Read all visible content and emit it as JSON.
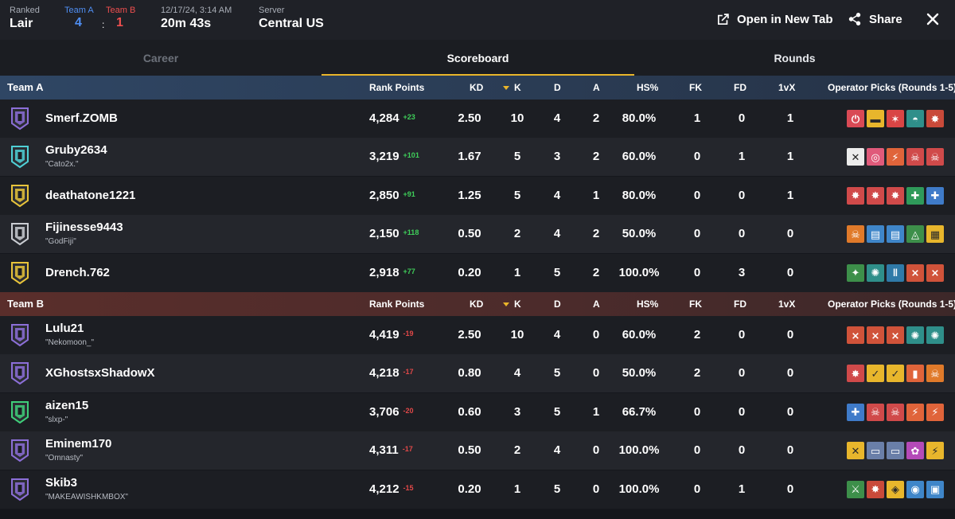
{
  "header": {
    "mode_label": "Ranked",
    "map": "Lair",
    "team_a_label": "Team A",
    "team_b_label": "Team B",
    "team_a_score": "4",
    "team_b_score": "1",
    "score_separator": ":",
    "datetime": "12/17/24, 3:14 AM",
    "duration": "20m 43s",
    "server_label": "Server",
    "server": "Central US",
    "open_new_tab": "Open in New Tab",
    "share": "Share"
  },
  "tabs": [
    {
      "label": "Career"
    },
    {
      "label": "Scoreboard"
    },
    {
      "label": "Rounds"
    }
  ],
  "columns": {
    "rank_points": "Rank Points",
    "kd": "KD",
    "k": "K",
    "d": "D",
    "a": "A",
    "hs": "HS%",
    "fk": "FK",
    "fd": "FD",
    "clutch": "1vX",
    "operators": "Operator Picks (Rounds 1-5)"
  },
  "teams": [
    {
      "name": "Team A",
      "players": [
        {
          "name": "Smerf.ZOMB",
          "nick": "",
          "rank_color": "#8c6fd8",
          "rp": "4,284",
          "delta": "+23",
          "kd": "2.50",
          "k": "10",
          "d": "4",
          "a": "2",
          "hs": "80.0%",
          "fk": "1",
          "fd": "0",
          "clutch": "1",
          "ops": [
            {
              "bg": "#d94a55",
              "fg": "#ffffff",
              "glyph": "⏻"
            },
            {
              "bg": "#e8b62c",
              "fg": "#2a2a2a",
              "glyph": "▬"
            },
            {
              "bg": "#d94545",
              "fg": "#ffffff",
              "glyph": "✶"
            },
            {
              "bg": "#2f8f8a",
              "fg": "#ffffff",
              "glyph": "◓"
            },
            {
              "bg": "#c94a3a",
              "fg": "#ffffff",
              "glyph": "✸"
            }
          ]
        },
        {
          "name": "Gruby2634",
          "nick": "\"Cato2x.\"",
          "rank_color": "#4fd0d6",
          "rp": "3,219",
          "delta": "+101",
          "kd": "1.67",
          "k": "5",
          "d": "3",
          "a": "2",
          "hs": "60.0%",
          "fk": "0",
          "fd": "1",
          "clutch": "1",
          "ops": [
            {
              "bg": "#ececec",
              "fg": "#222222",
              "glyph": "✕"
            },
            {
              "bg": "#e05a7a",
              "fg": "#ffffff",
              "glyph": "◎"
            },
            {
              "bg": "#e0643a",
              "fg": "#ffffff",
              "glyph": "⚡"
            },
            {
              "bg": "#d04a4a",
              "fg": "#ffffff",
              "glyph": "☠"
            },
            {
              "bg": "#d04a4a",
              "fg": "#ffffff",
              "glyph": "☠"
            }
          ]
        },
        {
          "name": "deathatone1221",
          "nick": "",
          "rank_color": "#e8c43a",
          "rp": "2,850",
          "delta": "+91",
          "kd": "1.25",
          "k": "5",
          "d": "4",
          "a": "1",
          "hs": "80.0%",
          "fk": "0",
          "fd": "0",
          "clutch": "1",
          "ops": [
            {
              "bg": "#d04a4a",
              "fg": "#ffffff",
              "glyph": "✸"
            },
            {
              "bg": "#d04a4a",
              "fg": "#ffffff",
              "glyph": "✸"
            },
            {
              "bg": "#d04a4a",
              "fg": "#ffffff",
              "glyph": "✸"
            },
            {
              "bg": "#2f9a5a",
              "fg": "#ffffff",
              "glyph": "✚"
            },
            {
              "bg": "#3f7bc9",
              "fg": "#ffffff",
              "glyph": "✚"
            }
          ]
        },
        {
          "name": "Fijinesse9443",
          "nick": "\"GodFiji\"",
          "rank_color": "#c9ccd2",
          "rp": "2,150",
          "delta": "+118",
          "kd": "0.50",
          "k": "2",
          "d": "4",
          "a": "2",
          "hs": "50.0%",
          "fk": "0",
          "fd": "0",
          "clutch": "0",
          "ops": [
            {
              "bg": "#e07a2a",
              "fg": "#ffffff",
              "glyph": "☠"
            },
            {
              "bg": "#3f86c9",
              "fg": "#ffffff",
              "glyph": "▤"
            },
            {
              "bg": "#3f86c9",
              "fg": "#ffffff",
              "glyph": "▤"
            },
            {
              "bg": "#3d8f4a",
              "fg": "#ffffff",
              "glyph": "◬"
            },
            {
              "bg": "#e8b62c",
              "fg": "#2a2a2a",
              "glyph": "▦"
            }
          ]
        },
        {
          "name": "Drench.762",
          "nick": "",
          "rank_color": "#e8c43a",
          "rp": "2,918",
          "delta": "+77",
          "kd": "0.20",
          "k": "1",
          "d": "5",
          "a": "2",
          "hs": "100.0%",
          "fk": "0",
          "fd": "3",
          "clutch": "0",
          "ops": [
            {
              "bg": "#3d8f4a",
              "fg": "#ffffff",
              "glyph": "✦"
            },
            {
              "bg": "#2f8f8a",
              "fg": "#ffffff",
              "glyph": "✺"
            },
            {
              "bg": "#2f7aa8",
              "fg": "#ffffff",
              "glyph": "‖"
            },
            {
              "bg": "#d0533a",
              "fg": "#ffffff",
              "glyph": "⨯"
            },
            {
              "bg": "#d0533a",
              "fg": "#ffffff",
              "glyph": "⨯"
            }
          ]
        }
      ]
    },
    {
      "name": "Team B",
      "players": [
        {
          "name": "Lulu21",
          "nick": "\"Nekomoon_\"",
          "rank_color": "#8c6fd8",
          "rp": "4,419",
          "delta": "-19",
          "kd": "2.50",
          "k": "10",
          "d": "4",
          "a": "0",
          "hs": "60.0%",
          "fk": "2",
          "fd": "0",
          "clutch": "0",
          "ops": [
            {
              "bg": "#d0533a",
              "fg": "#ffffff",
              "glyph": "⨯"
            },
            {
              "bg": "#d0533a",
              "fg": "#ffffff",
              "glyph": "⨯"
            },
            {
              "bg": "#d0533a",
              "fg": "#ffffff",
              "glyph": "⨯"
            },
            {
              "bg": "#2f8f8a",
              "fg": "#ffffff",
              "glyph": "✺"
            },
            {
              "bg": "#2f8f8a",
              "fg": "#ffffff",
              "glyph": "✺"
            }
          ]
        },
        {
          "name": "XGhostsxShadowX",
          "nick": "",
          "rank_color": "#8c6fd8",
          "rp": "4,218",
          "delta": "-17",
          "kd": "0.80",
          "k": "4",
          "d": "5",
          "a": "0",
          "hs": "50.0%",
          "fk": "2",
          "fd": "0",
          "clutch": "0",
          "ops": [
            {
              "bg": "#d04a4a",
              "fg": "#ffffff",
              "glyph": "✸"
            },
            {
              "bg": "#e8b62c",
              "fg": "#2a2a2a",
              "glyph": "✓"
            },
            {
              "bg": "#e8b62c",
              "fg": "#2a2a2a",
              "glyph": "✓"
            },
            {
              "bg": "#e0643a",
              "fg": "#ffffff",
              "glyph": "▮"
            },
            {
              "bg": "#e07a2a",
              "fg": "#ffffff",
              "glyph": "☠"
            }
          ]
        },
        {
          "name": "aizen15",
          "nick": "\"slxp-\"",
          "rank_color": "#3fcf7a",
          "rp": "3,706",
          "delta": "-20",
          "kd": "0.60",
          "k": "3",
          "d": "5",
          "a": "1",
          "hs": "66.7%",
          "fk": "0",
          "fd": "0",
          "clutch": "0",
          "ops": [
            {
              "bg": "#3f7bc9",
              "fg": "#ffffff",
              "glyph": "✚"
            },
            {
              "bg": "#d04a4a",
              "fg": "#ffffff",
              "glyph": "☠"
            },
            {
              "bg": "#d04a4a",
              "fg": "#ffffff",
              "glyph": "☠"
            },
            {
              "bg": "#e0643a",
              "fg": "#ffffff",
              "glyph": "⚡"
            },
            {
              "bg": "#e0643a",
              "fg": "#ffffff",
              "glyph": "⚡"
            }
          ]
        },
        {
          "name": "Eminem170",
          "nick": "\"Omnasty\"",
          "rank_color": "#8c6fd8",
          "rp": "4,311",
          "delta": "-17",
          "kd": "0.50",
          "k": "2",
          "d": "4",
          "a": "0",
          "hs": "100.0%",
          "fk": "0",
          "fd": "0",
          "clutch": "0",
          "ops": [
            {
              "bg": "#e8b62c",
              "fg": "#2a2a2a",
              "glyph": "✕"
            },
            {
              "bg": "#6a7fa8",
              "fg": "#ffffff",
              "glyph": "▭"
            },
            {
              "bg": "#6a7fa8",
              "fg": "#ffffff",
              "glyph": "▭"
            },
            {
              "bg": "#b44ab8",
              "fg": "#ffffff",
              "glyph": "✿"
            },
            {
              "bg": "#e8b62c",
              "fg": "#2a2a2a",
              "glyph": "⚡"
            }
          ]
        },
        {
          "name": "Skib3",
          "nick": "\"MAKEAWISHKMBOX\"",
          "rank_color": "#8c6fd8",
          "rp": "4,212",
          "delta": "-15",
          "kd": "0.20",
          "k": "1",
          "d": "5",
          "a": "0",
          "hs": "100.0%",
          "fk": "0",
          "fd": "1",
          "clutch": "0",
          "ops": [
            {
              "bg": "#3d8f4a",
              "fg": "#ffffff",
              "glyph": "⚔"
            },
            {
              "bg": "#c94a3a",
              "fg": "#ffffff",
              "glyph": "✸"
            },
            {
              "bg": "#e8b62c",
              "fg": "#2a2a2a",
              "glyph": "◈"
            },
            {
              "bg": "#3f86c9",
              "fg": "#ffffff",
              "glyph": "◉"
            },
            {
              "bg": "#3f86c9",
              "fg": "#ffffff",
              "glyph": "▣"
            }
          ]
        }
      ]
    }
  ]
}
